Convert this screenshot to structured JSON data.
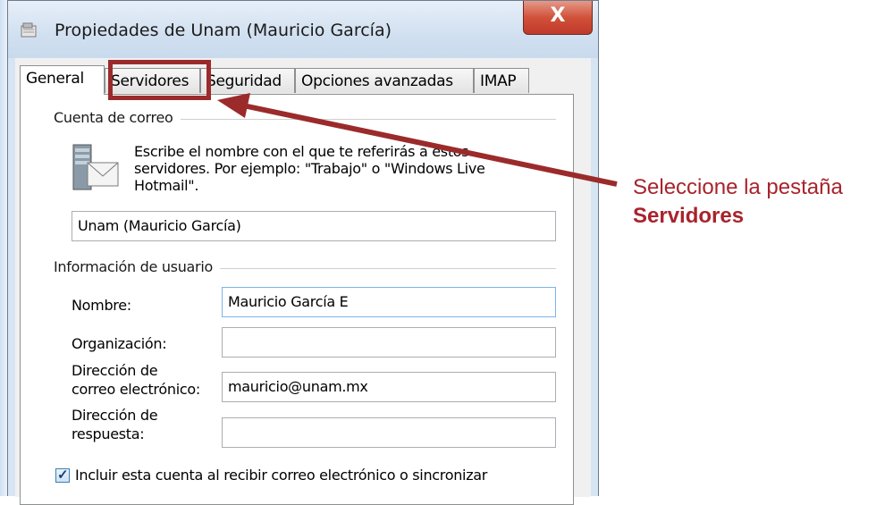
{
  "window": {
    "title": "Propiedades de Unam (Mauricio García)",
    "close_label": "X"
  },
  "tabs": [
    {
      "label": "General",
      "active": true
    },
    {
      "label": "Servidores",
      "active": false
    },
    {
      "label": "Seguridad",
      "active": false
    },
    {
      "label": "Opciones avanzadas",
      "active": false
    },
    {
      "label": "IMAP",
      "active": false
    }
  ],
  "mail_account": {
    "group_label": "Cuenta de correo",
    "description": "Escribe el nombre con el que te referirás a estos servidores. Por ejemplo: \"Trabajo\" o \"Windows Live Hotmail\".",
    "account_name": "Unam (Mauricio García)"
  },
  "user_info": {
    "group_label": "Información de usuario",
    "name_label": "Nombre:",
    "name_value": "Mauricio García E",
    "org_label": "Organización:",
    "org_value": "",
    "email_label_1": "Dirección de",
    "email_label_2": "correo electrónico:",
    "email_value": "mauricio@unam.mx",
    "reply_label_1": "Dirección de",
    "reply_label_2": "respuesta:",
    "reply_value": ""
  },
  "checkbox": {
    "label": "Incluir esta cuenta al recibir correo electrónico o sincronizar",
    "checked": true
  },
  "annotation": {
    "line1": "Seleccione la pestaña",
    "line2": "Servidores",
    "color": "#a8232c"
  }
}
